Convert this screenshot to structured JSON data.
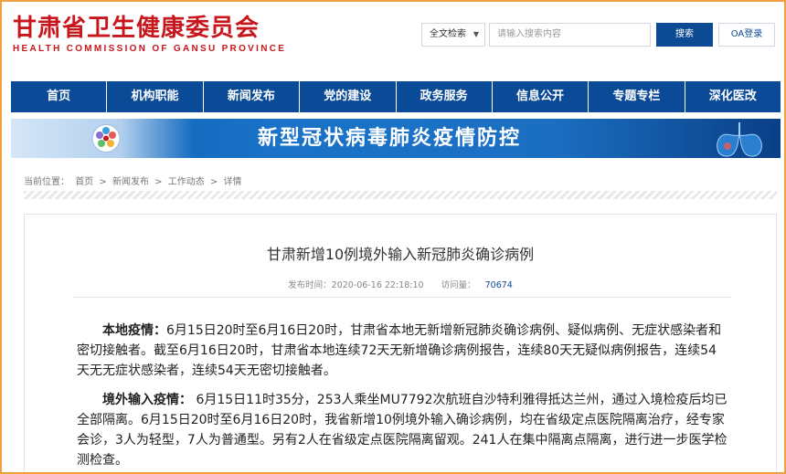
{
  "header": {
    "brand_cn": "甘肃省卫生健康委员会",
    "brand_en": "HEALTH COMMISSION OF GANSU PROVINCE",
    "search_type": "全文检索",
    "search_placeholder": "请输入搜索内容",
    "search_button": "搜索",
    "oa_button": "OA登录"
  },
  "nav": {
    "items": [
      "首页",
      "机构职能",
      "新闻发布",
      "党的建设",
      "政务服务",
      "信息公开",
      "专题专栏",
      "深化医改"
    ]
  },
  "banner": {
    "text": "新型冠状病毒肺炎疫情防控"
  },
  "breadcrumb": {
    "label": "当前位置：",
    "items": [
      "首页",
      ">",
      "新闻发布",
      ">",
      "工作动态",
      ">",
      "详情"
    ]
  },
  "article": {
    "title": "甘肃新增10例境外输入新冠肺炎确诊病例",
    "published_label": "发布时间：",
    "published": "2020-06-16 22:18:10",
    "visits_label": "访问量：",
    "visits": "70674",
    "p1_lead": "本地疫情：",
    "p1_body": "6月15日20时至6月16日20时，甘肃省本地无新增新冠肺炎确诊病例、疑似病例、无症状感染者和密切接触者。截至6月16日20时，甘肃省本地连续72天无新增确诊病例报告，连续80天无疑似病例报告，连续54天无无症状感染者，连续54天无密切接触者。",
    "p2_lead": "境外输入疫情：",
    "p2_body": " 6月15日11时35分，253人乘坐MU7792次航班自沙特利雅得抵达兰州，通过入境检疫后均已全部隔离。6月15日20时至6月16日20时，我省新增10例境外输入确诊病例，均在省级定点医院隔离治疗，经专家会诊，3人为轻型，7人为普通型。另有2人在省级定点医院隔离留观。241人在集中隔离点隔离，进行进一步医学检测检查。"
  },
  "colors": {
    "brand_red": "#c8161d",
    "nav_blue": "#0a4a97",
    "frame_orange": "#f0a040"
  }
}
